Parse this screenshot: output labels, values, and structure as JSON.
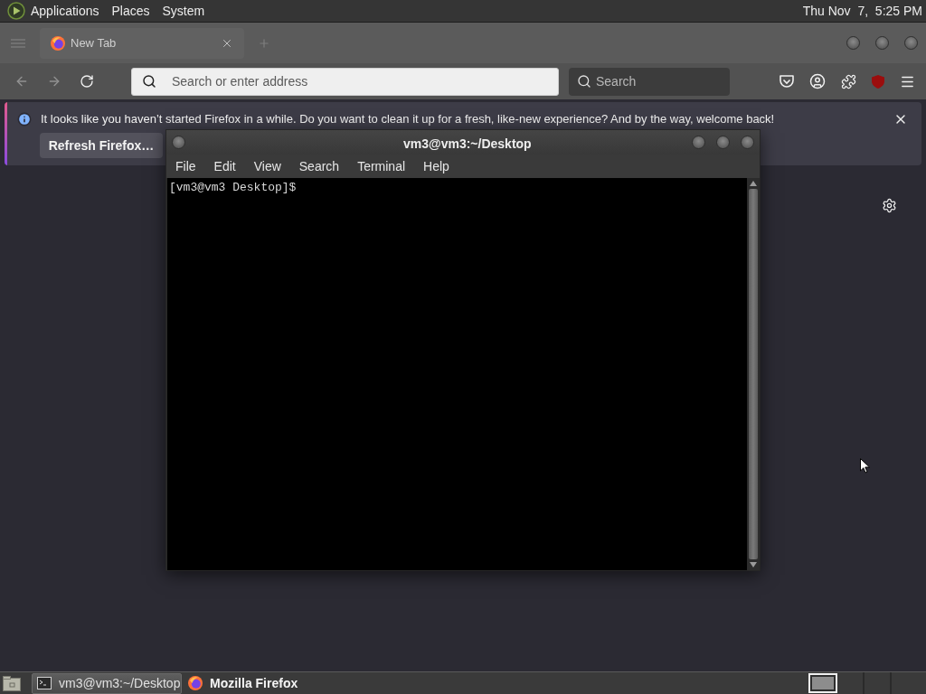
{
  "top_panel": {
    "menus": [
      "Applications",
      "Places",
      "System"
    ],
    "clock": "Thu Nov  7,  5:25 PM"
  },
  "browser": {
    "tabs": [
      {
        "label": "New Tab",
        "selected": true
      }
    ],
    "nav_buttons": [
      {
        "kind": "back",
        "disabled": true
      },
      {
        "kind": "forward",
        "disabled": true
      },
      {
        "kind": "reload",
        "disabled": false
      }
    ],
    "address_bar": {
      "placeholder": "Search or enter address"
    },
    "search_bar": {
      "placeholder": "Search"
    },
    "notification": {
      "message": "It looks like you haven’t started Firefox in a while. Do you want to clean it up for a fresh, like-new experience? And by the way, welcome back!",
      "button": "Refresh Firefox…"
    }
  },
  "terminal": {
    "title": "vm3@vm3:~/Desktop",
    "menus": [
      "File",
      "Edit",
      "View",
      "Search",
      "Terminal",
      "Help"
    ],
    "lines": [
      "[vm3@vm3 Desktop]$"
    ]
  },
  "taskbar": {
    "tasks": [
      {
        "kind": "terminal",
        "label": "vm3@vm3:~/Desktop",
        "selected": true,
        "attention": false
      },
      {
        "kind": "browser",
        "label": "Mozilla Firefox",
        "selected": false,
        "attention": true
      }
    ]
  }
}
